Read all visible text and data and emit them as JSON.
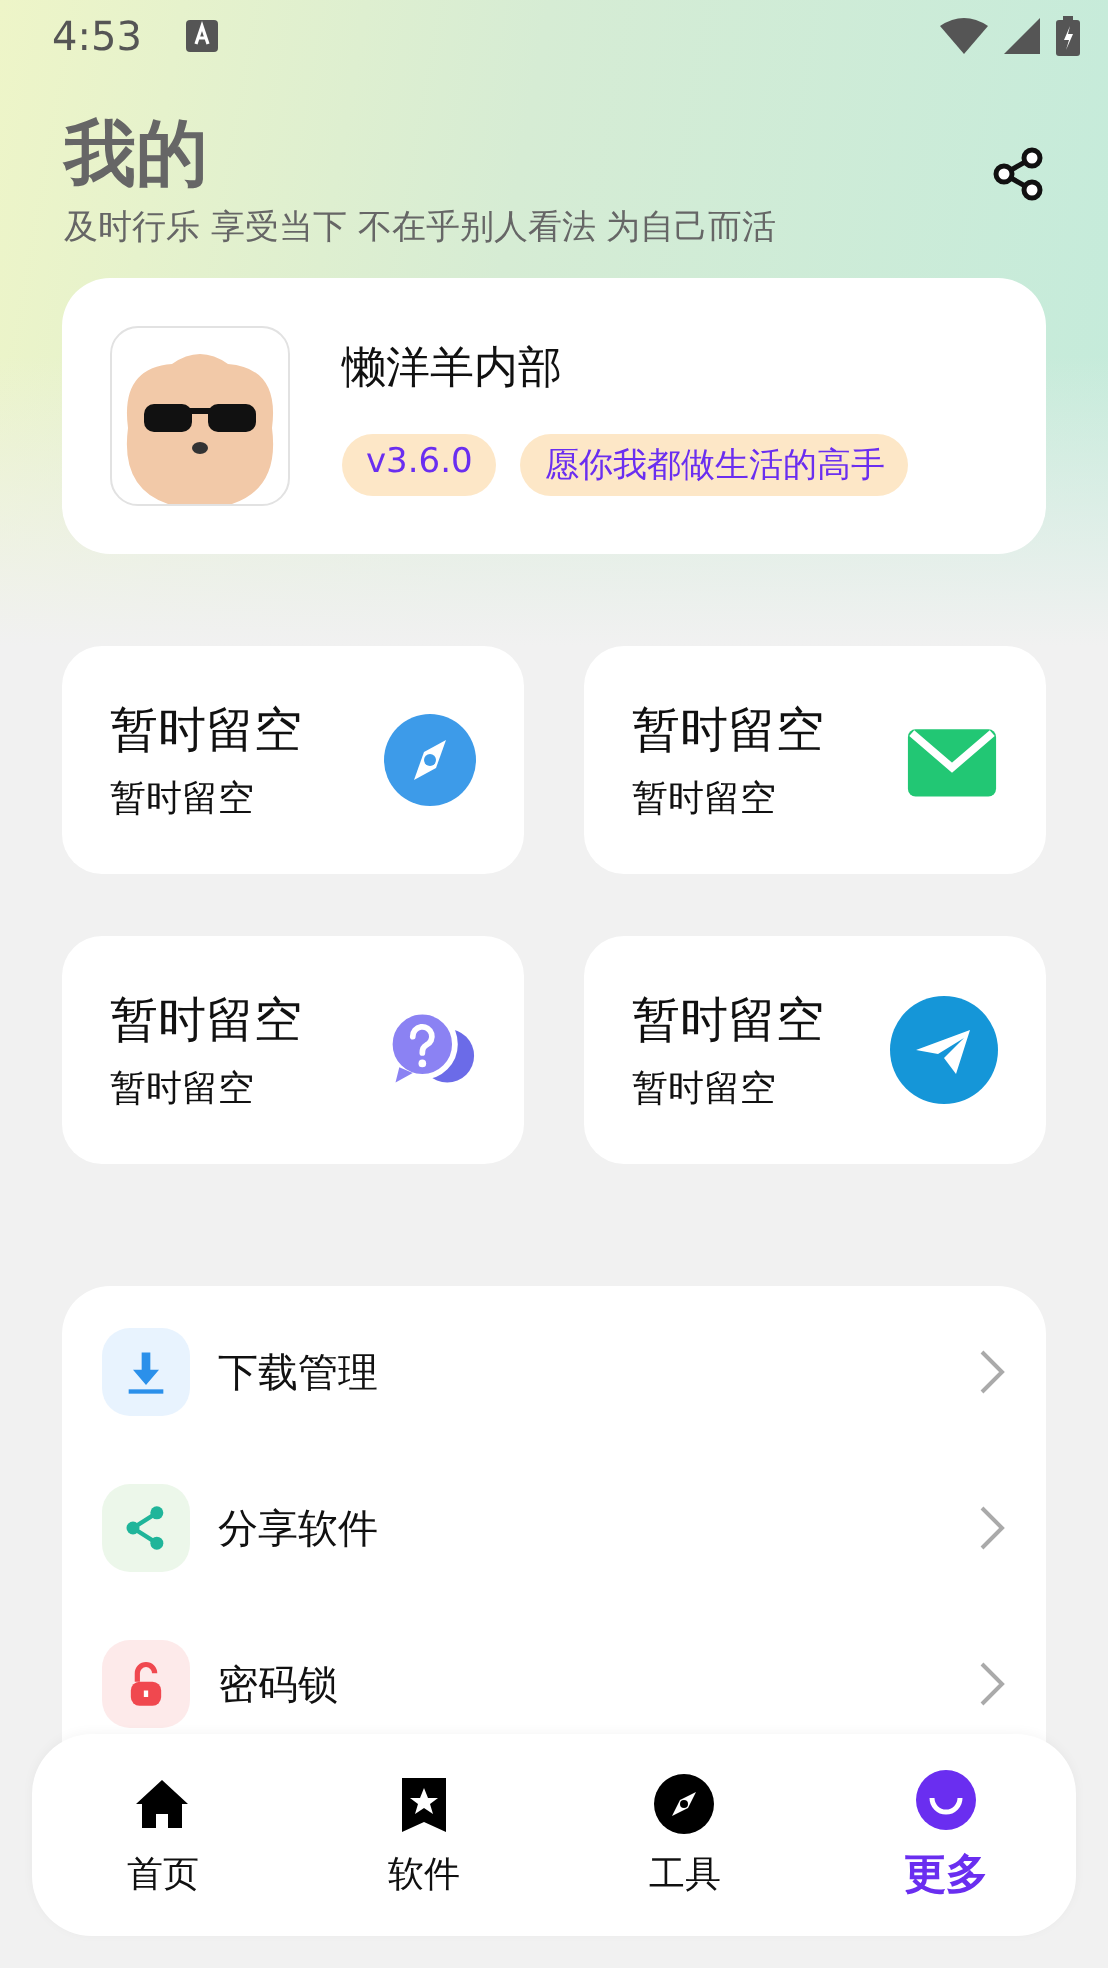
{
  "status_bar": {
    "time": "4:53"
  },
  "header": {
    "title": "我的",
    "subtitle": "及时行乐 享受当下 不在乎别人看法 为自己而活"
  },
  "profile": {
    "name": "懒洋羊内部",
    "badges": [
      "v3.6.0",
      "愿你我都做生活的高手"
    ]
  },
  "tiles": [
    {
      "kind": "compass",
      "title": "暂时留空",
      "subtitle": "暂时留空"
    },
    {
      "kind": "mail",
      "title": "暂时留空",
      "subtitle": "暂时留空"
    },
    {
      "kind": "help",
      "title": "暂时留空",
      "subtitle": "暂时留空"
    },
    {
      "kind": "send",
      "title": "暂时留空",
      "subtitle": "暂时留空"
    }
  ],
  "menu": [
    {
      "kind": "download",
      "label": "下载管理"
    },
    {
      "kind": "share",
      "label": "分享软件"
    },
    {
      "kind": "lock",
      "label": "密码锁"
    }
  ],
  "bottom_nav": [
    {
      "kind": "home",
      "label": "首页",
      "selected": false
    },
    {
      "kind": "apps",
      "label": "软件",
      "selected": false
    },
    {
      "kind": "tools",
      "label": "工具",
      "selected": false
    },
    {
      "kind": "more",
      "label": "更多",
      "selected": true
    }
  ]
}
